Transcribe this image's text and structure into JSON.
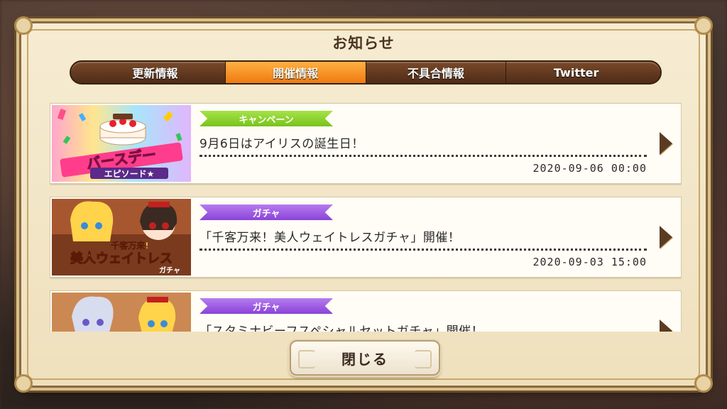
{
  "dialog": {
    "title": "お知らせ"
  },
  "tabs": [
    {
      "label": "更新情報",
      "active": false
    },
    {
      "label": "開催情報",
      "active": true
    },
    {
      "label": "不具合情報",
      "active": false
    },
    {
      "label": "Twitter",
      "active": false
    }
  ],
  "notices": [
    {
      "tag": "キャンペーン",
      "tag_color": "#8fd32e",
      "title": "9月6日はアイリスの誕生日！",
      "date": "2020-09-06 00:00",
      "banner_text": [
        "バースデー",
        "エピソード★"
      ],
      "banner_name": "birthday-episode-banner"
    },
    {
      "tag": "ガチャ",
      "tag_color": "#9b55e3",
      "title": "「千客万来！美人ウェイトレスガチャ」開催！",
      "date": "2020-09-03 15:00",
      "banner_text": [
        "千客万来!",
        "美人ウェイトレス",
        "ガチャ"
      ],
      "banner_name": "waitress-gacha-banner"
    },
    {
      "tag": "ガチャ",
      "tag_color": "#9b55e3",
      "title": "「スタミナビーフスペシャルセットガチャ」開催！",
      "date": "",
      "banner_text": [],
      "banner_name": "beef-gacha-banner"
    }
  ],
  "close_button": {
    "label": "閉じる"
  },
  "colors": {
    "active_tab": "#f08a1c",
    "frame": "#8a6a3e",
    "parchment": "#f3e6c8"
  }
}
